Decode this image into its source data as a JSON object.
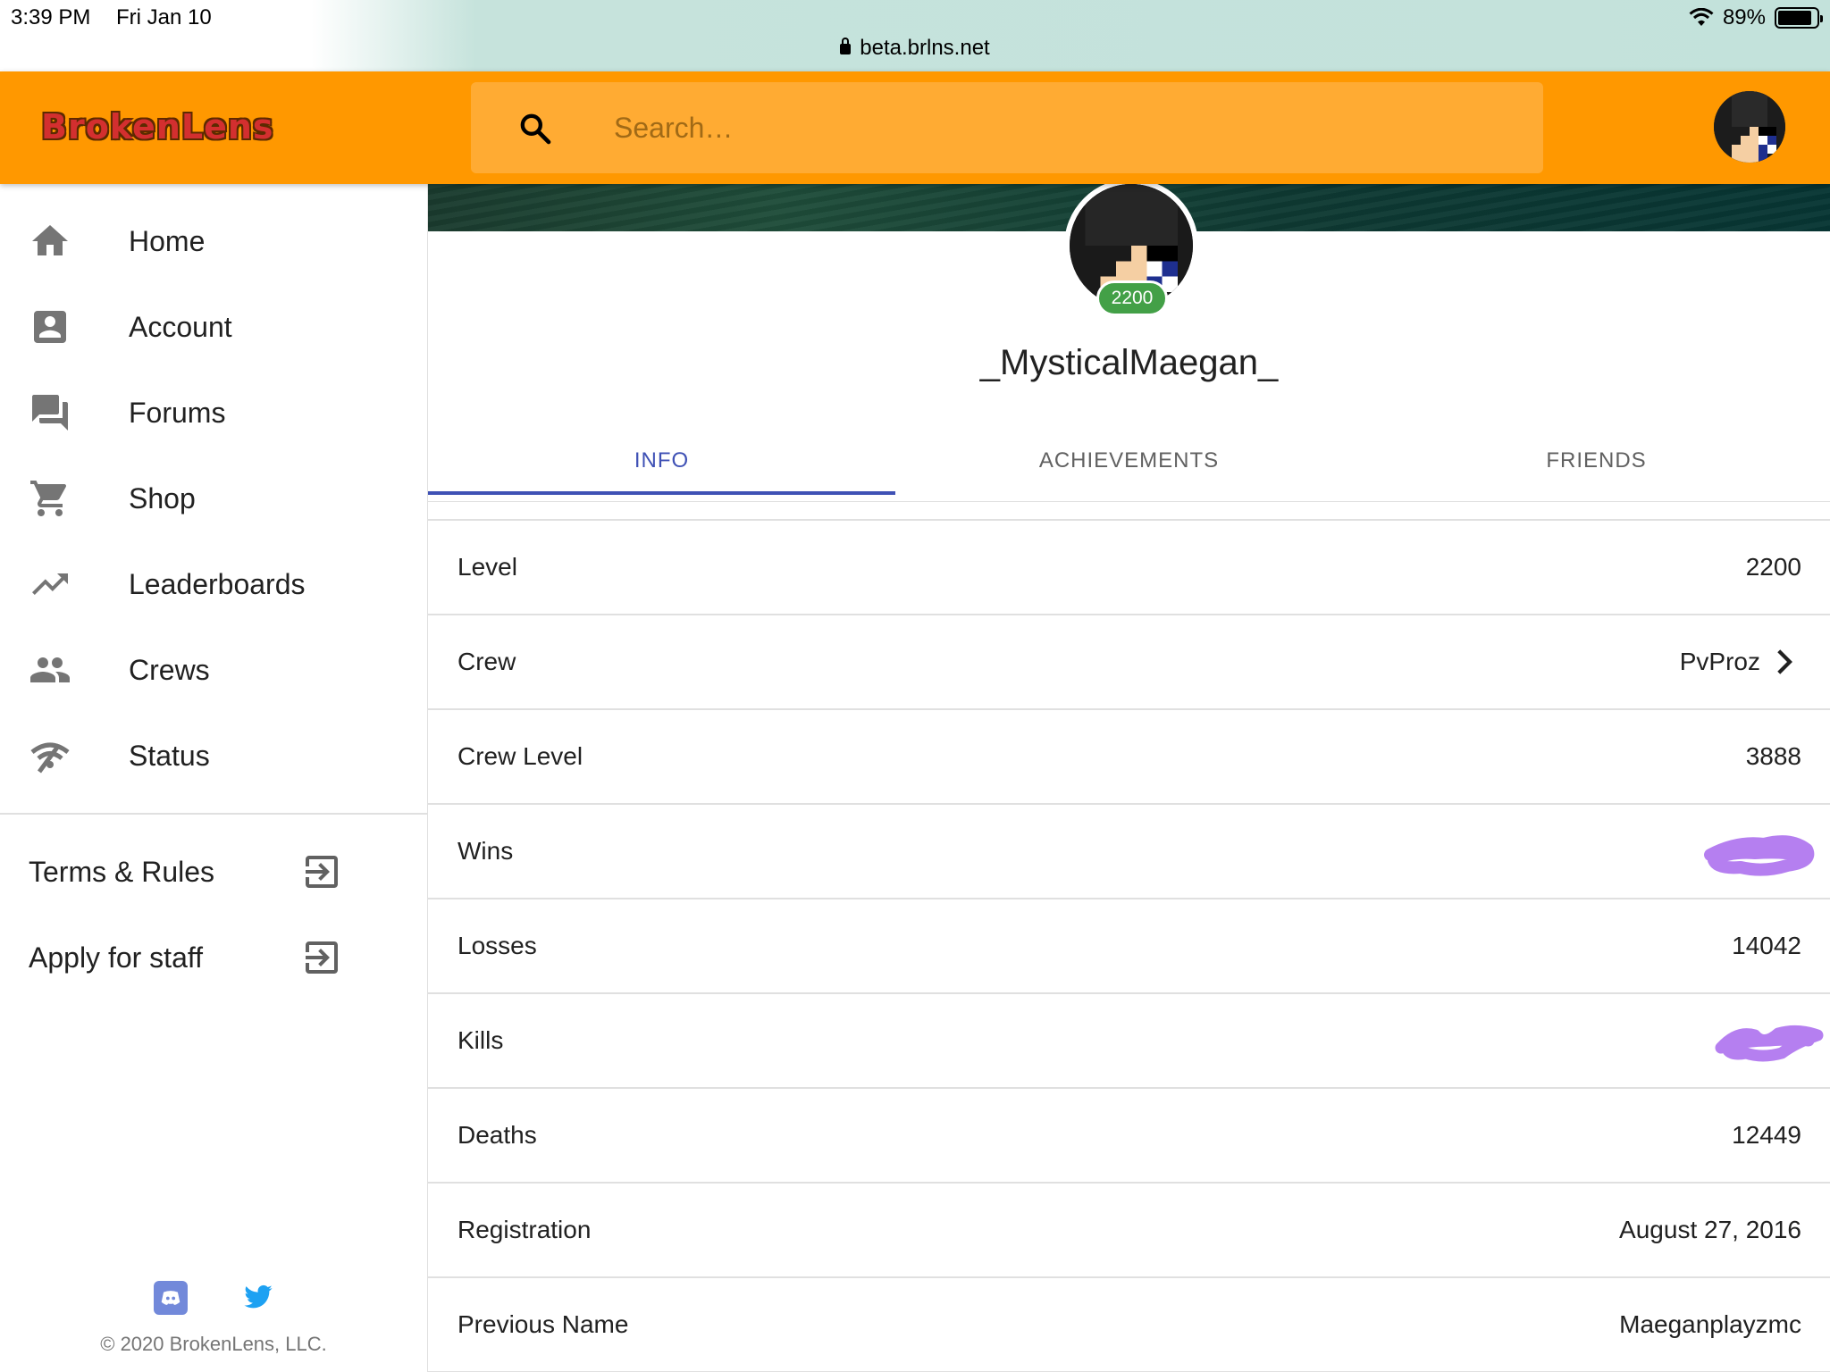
{
  "status_bar": {
    "time": "3:39 PM",
    "date": "Fri Jan 10",
    "url": "beta.brlns.net",
    "battery": "89%",
    "battery_level": 0.89
  },
  "header": {
    "logo": "BrokenLens",
    "search_placeholder": "Search…",
    "accent_color": "#ff9800"
  },
  "sidebar": {
    "items": [
      {
        "label": "Home",
        "icon": "home-icon"
      },
      {
        "label": "Account",
        "icon": "account-box-icon"
      },
      {
        "label": "Forums",
        "icon": "forum-icon"
      },
      {
        "label": "Shop",
        "icon": "cart-icon"
      },
      {
        "label": "Leaderboards",
        "icon": "trending-up-icon"
      },
      {
        "label": "Crews",
        "icon": "people-icon"
      },
      {
        "label": "Status",
        "icon": "signal-off-icon"
      }
    ],
    "external_links": [
      {
        "label": "Terms & Rules",
        "icon": "exit-to-app-icon"
      },
      {
        "label": "Apply for staff",
        "icon": "exit-to-app-icon"
      }
    ],
    "social": [
      "discord-icon",
      "twitter-icon"
    ],
    "copyright": "© 2020 BrokenLens, LLC."
  },
  "profile": {
    "level_badge": "2200",
    "username": "_MysticalMaegan_",
    "tabs": [
      {
        "label": "INFO",
        "active": true
      },
      {
        "label": "ACHIEVEMENTS",
        "active": false
      },
      {
        "label": "FRIENDS",
        "active": false
      }
    ],
    "active_tab_color": "#3f51b5",
    "info": [
      {
        "label": "Level",
        "value": "2200"
      },
      {
        "label": "Crew",
        "value": "PvProz"
      },
      {
        "label": "Crew Level",
        "value": "3888"
      },
      {
        "label": "Wins",
        "value": ""
      },
      {
        "label": "Losses",
        "value": "14042"
      },
      {
        "label": "Kills",
        "value": ""
      },
      {
        "label": "Deaths",
        "value": "12449"
      },
      {
        "label": "Registration",
        "value": "August 27, 2016"
      },
      {
        "label": "Previous Name",
        "value": "Maeganplayzmc"
      }
    ]
  }
}
